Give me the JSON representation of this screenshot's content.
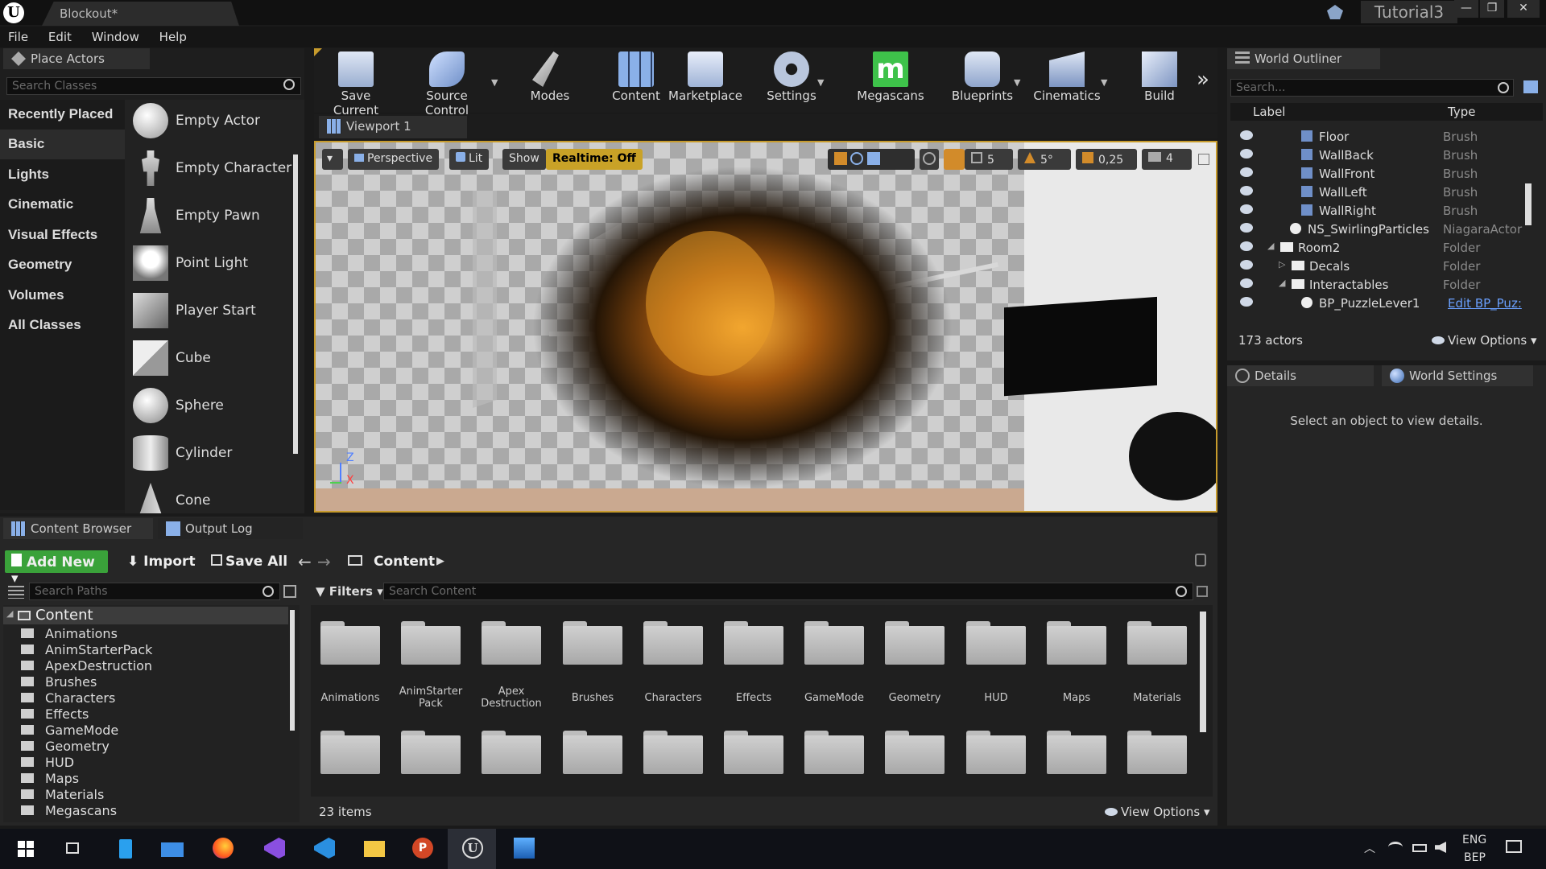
{
  "window": {
    "tab_title": "Blockout*",
    "project": "Tutorial3"
  },
  "menu": [
    "File",
    "Edit",
    "Window",
    "Help"
  ],
  "place_actors": {
    "tab": "Place Actors",
    "search_placeholder": "Search Classes",
    "categories": [
      "Recently Placed",
      "Basic",
      "Lights",
      "Cinematic",
      "Visual Effects",
      "Geometry",
      "Volumes",
      "All Classes"
    ],
    "selected_category": "Basic",
    "actors": [
      "Empty Actor",
      "Empty Character",
      "Empty Pawn",
      "Point Light",
      "Player Start",
      "Cube",
      "Sphere",
      "Cylinder",
      "Cone"
    ]
  },
  "toolbar": [
    "Save Current",
    "Source Control",
    "Modes",
    "Content",
    "Marketplace",
    "Settings",
    "Megascans",
    "Blueprints",
    "Cinematics",
    "Build"
  ],
  "viewport": {
    "tab": "Viewport 1",
    "perspective": "Perspective",
    "lit": "Lit",
    "show": "Show",
    "realtime": "Realtime: Off",
    "grid_snap": "5",
    "rot_snap": "5°",
    "scale_snap": "0,25",
    "cam_speed": "4",
    "axis_z": "Z",
    "axis_x": "X"
  },
  "outliner": {
    "tab": "World Outliner",
    "search_placeholder": "Search...",
    "col_label": "Label",
    "col_type": "Type",
    "rows": [
      {
        "label": "Floor",
        "type": "Brush"
      },
      {
        "label": "WallBack",
        "type": "Brush"
      },
      {
        "label": "WallFront",
        "type": "Brush"
      },
      {
        "label": "WallLeft",
        "type": "Brush"
      },
      {
        "label": "WallRight",
        "type": "Brush"
      },
      {
        "label": "NS_SwirlingParticles",
        "type": "NiagaraActor"
      },
      {
        "label": "Room2",
        "type": "Folder"
      },
      {
        "label": "Decals",
        "type": "Folder"
      },
      {
        "label": "Interactables",
        "type": "Folder"
      },
      {
        "label": "BP_PuzzleLever1",
        "type": "Edit BP_Puz:"
      }
    ],
    "count": "173 actors",
    "view_options": "View Options"
  },
  "details": {
    "tab": "Details",
    "tab2": "World Settings",
    "empty": "Select an object to view details."
  },
  "content_browser": {
    "tab": "Content Browser",
    "tab2": "Output Log",
    "add_new": "Add New",
    "import": "Import",
    "save_all": "Save All",
    "path": "Content",
    "search_paths": "Search Paths",
    "filters": "Filters",
    "search_content": "Search Content",
    "tree_root": "Content",
    "tree": [
      "Animations",
      "AnimStarterPack",
      "ApexDestruction",
      "Brushes",
      "Characters",
      "Effects",
      "GameMode",
      "Geometry",
      "HUD",
      "Maps",
      "Materials",
      "Megascans"
    ],
    "folders": [
      "Animations",
      "AnimStarter Pack",
      "Apex Destruction",
      "Brushes",
      "Characters",
      "Effects",
      "GameMode",
      "Geometry",
      "HUD",
      "Maps",
      "Materials"
    ],
    "items": "23 items",
    "view_options": "View Options"
  },
  "taskbar": {
    "lang": "ENG",
    "layout": "BEP"
  }
}
